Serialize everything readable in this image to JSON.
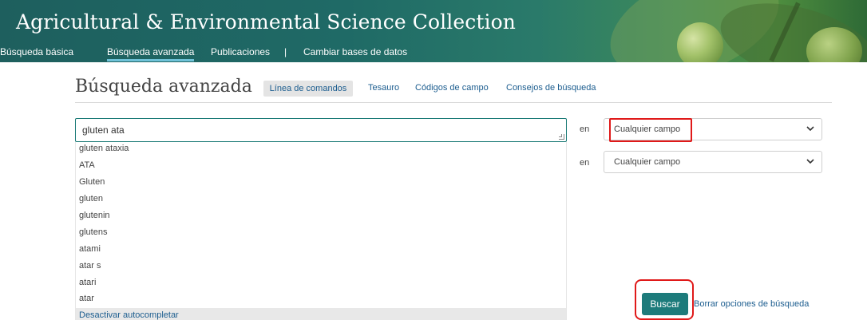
{
  "app": {
    "title": "Agricultural & Environmental Science Collection"
  },
  "nav": {
    "items": [
      {
        "label": "Búsqueda básica"
      },
      {
        "label": "Búsqueda avanzada"
      },
      {
        "label": "Publicaciones"
      },
      {
        "label": "Cambiar bases de datos"
      }
    ],
    "separator": "|",
    "active": "Búsqueda avanzada"
  },
  "page": {
    "title": "Búsqueda avanzada",
    "tabs": [
      {
        "label": "Línea de comandos",
        "active": true
      },
      {
        "label": "Tesauro"
      },
      {
        "label": "Códigos de campo"
      },
      {
        "label": "Consejos de búsqueda"
      }
    ]
  },
  "search": {
    "value": "gluten ata",
    "suggestions": [
      "gluten ataxia",
      "ATA",
      "Gluten",
      "gluten",
      "glutenin",
      "glutens",
      "atami",
      "atar s",
      "atari",
      "atar"
    ],
    "disable_autocomplete": "Desactivar autocompletar"
  },
  "fields": [
    {
      "connector": "en",
      "selected": "Cualquier campo"
    },
    {
      "connector": "en",
      "selected": "Cualquier campo"
    }
  ],
  "actions": {
    "search_label": "Buscar",
    "clear_label": "Borrar opciones de búsqueda"
  },
  "colors": {
    "header": "#1f6a66",
    "accent": "#1d7b7b",
    "link": "#1c5d8f",
    "highlight": "#e01919"
  }
}
